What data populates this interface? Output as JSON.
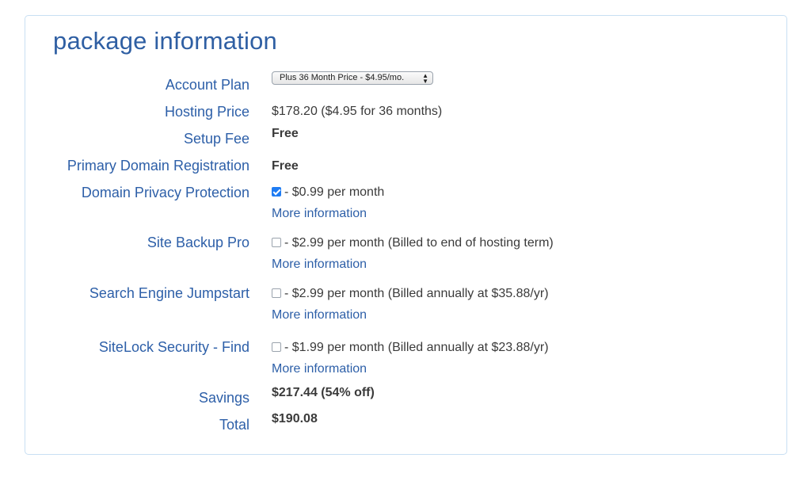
{
  "title": "package information",
  "rows": {
    "account_plan": {
      "label": "Account Plan",
      "select_value": "Plus 36 Month Price - $4.95/mo."
    },
    "hosting_price": {
      "label": "Hosting Price",
      "value": "$178.20  ($4.95 for 36 months)"
    },
    "setup_fee": {
      "label": "Setup Fee",
      "value": "Free"
    },
    "primary_domain": {
      "label": "Primary Domain Registration",
      "value": "Free"
    },
    "domain_privacy": {
      "label": "Domain Privacy Protection",
      "checked": true,
      "value": "- $0.99 per month",
      "more": "More information"
    },
    "site_backup": {
      "label": "Site Backup Pro",
      "checked": false,
      "value": "- $2.99 per month (Billed to end of hosting term)",
      "more": "More information"
    },
    "search_engine": {
      "label": "Search Engine Jumpstart",
      "checked": false,
      "value": "- $2.99 per month (Billed annually at $35.88/yr)",
      "more": "More information"
    },
    "sitelock": {
      "label": "SiteLock Security - Find",
      "checked": false,
      "value": "- $1.99 per month (Billed annually at $23.88/yr)",
      "more": "More information"
    },
    "savings": {
      "label": "Savings",
      "value": "$217.44 (54% off)"
    },
    "total": {
      "label": "Total",
      "value": "$190.08"
    }
  },
  "colors": {
    "label": "#2d5fa8",
    "border": "#c8dff3",
    "checkbox_checked": "#1f7cf3"
  }
}
